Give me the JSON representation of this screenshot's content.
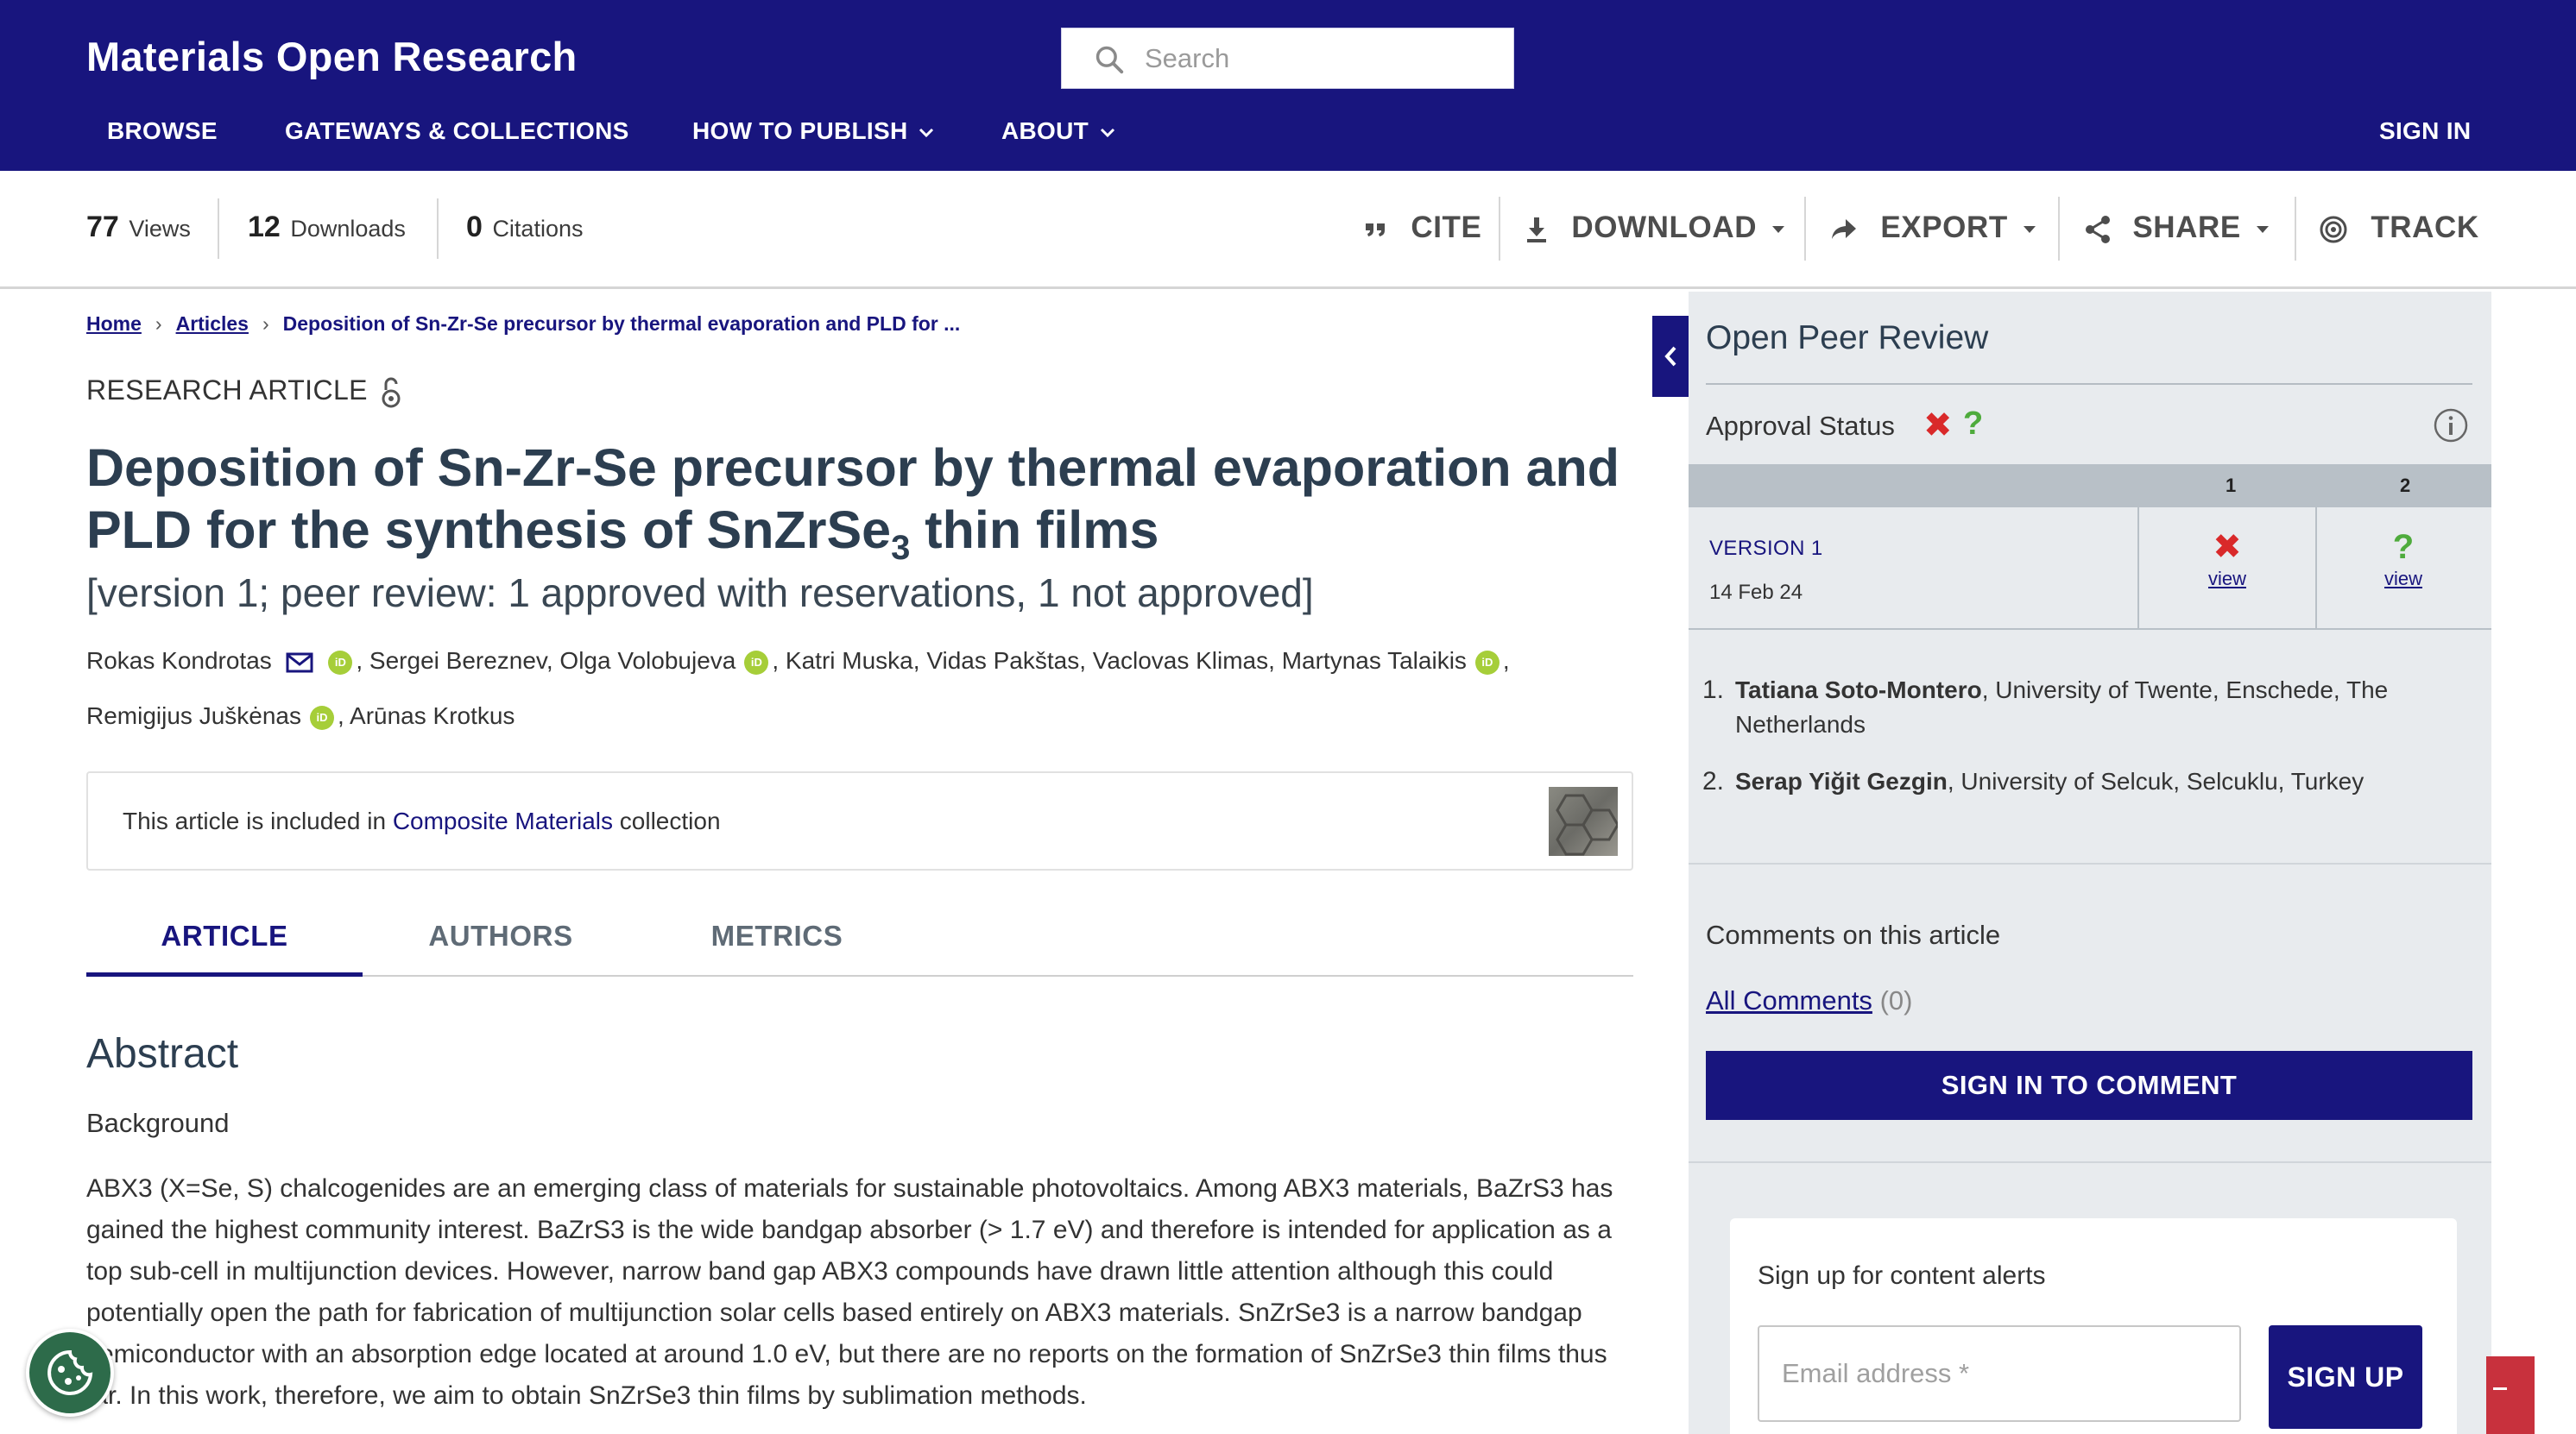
{
  "header": {
    "brand": "Materials Open Research",
    "search_placeholder": "Search",
    "nav": {
      "browse": "BROWSE",
      "gateways": "GATEWAYS & COLLECTIONS",
      "how_to_publish": "HOW TO PUBLISH",
      "about": "ABOUT",
      "sign_in": "SIGN IN"
    }
  },
  "metrics": {
    "views_count": "77",
    "views_label": "Views",
    "downloads_count": "12",
    "downloads_label": "Downloads",
    "citations_count": "0",
    "citations_label": "Citations"
  },
  "actions": {
    "cite": "CITE",
    "download": "DOWNLOAD",
    "export": "EXPORT",
    "share": "SHARE",
    "track": "TRACK"
  },
  "breadcrumb": {
    "home": "Home",
    "articles": "Articles",
    "current": "Deposition of Sn-Zr-Se precursor by thermal evaporation and PLD for ..."
  },
  "article": {
    "type": "RESEARCH ARTICLE",
    "title_main": "Deposition of Sn-Zr-Se precursor by thermal evaporation and PLD for the synthesis of SnZrSe",
    "title_sub": "3",
    "title_tail": " thin films",
    "version_line": "[version 1; peer review: 1 approved with reservations, 1 not approved]",
    "authors": [
      "Rokas Kondrotas",
      "Sergei Bereznev",
      "Olga Volobujeva",
      "Katri Muska",
      "Vidas Pakštas",
      "Vaclovas Klimas",
      "Martynas Talaikis",
      "Remigijus Juškėnas",
      "Arūnas Krotkus"
    ],
    "collection_prefix": "This article is included in ",
    "collection_name": "Composite Materials",
    "collection_suffix": " collection"
  },
  "tabs": {
    "article": "ARTICLE",
    "authors": "AUTHORS",
    "metrics": "METRICS"
  },
  "abstract": {
    "heading": "Abstract",
    "subheading": "Background",
    "text": "ABX3 (X=Se, S) chalcogenides are an emerging class of materials for sustainable photovoltaics. Among ABX3 materials, BaZrS3 has gained the highest community interest. BaZrS3 is the wide bandgap absorber (> 1.7 eV) and therefore is intended for application as a top sub-cell in multijunction devices. However, narrow band gap ABX3 compounds have drawn little attention although this could potentially open the path for fabrication of multijunction solar cells based entirely on ABX3 materials. SnZrSe3 is a narrow bandgap semiconductor with an absorption edge located at around 1.0 eV, but there are no reports on the formation of SnZrSe3 thin films thus far. In this work, therefore, we aim to obtain SnZrSe3 thin films by sublimation methods."
  },
  "peer_review": {
    "heading": "Open Peer Review",
    "approval_label": "Approval Status",
    "approval_marks": [
      "✖",
      "?"
    ],
    "columns": [
      "1",
      "2"
    ],
    "version_label": "VERSION 1",
    "version_date": "14 Feb 24",
    "view_label": "view",
    "reviewers": [
      {
        "num": "1.",
        "name": "Tatiana Soto-Montero",
        "affiliation": ", University of Twente, Enschede, The Netherlands"
      },
      {
        "num": "2.",
        "name": "Serap Yiğit Gezgin",
        "affiliation": ", University of Selcuk, Selcuklu, Turkey"
      }
    ],
    "comments_heading": "Comments on this article",
    "all_comments": "All Comments",
    "comment_count": "(0)",
    "sign_in_comment": "SIGN IN TO COMMENT"
  },
  "alerts": {
    "heading": "Sign up for content alerts",
    "email_placeholder": "Email address *",
    "signup": "SIGN UP"
  },
  "colors": {
    "brand": "#18157e",
    "not_approved": "#d9292a",
    "reservations": "#4eab3c",
    "orcid": "#a6ce39"
  }
}
